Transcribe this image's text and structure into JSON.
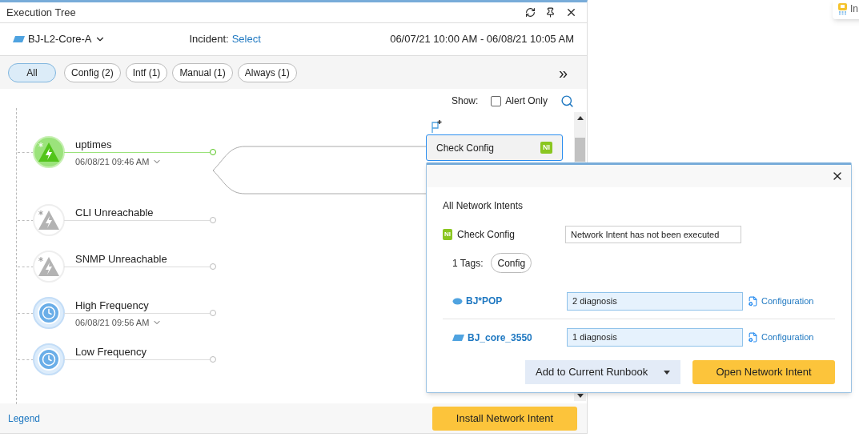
{
  "window": {
    "title": "Execution Tree"
  },
  "device": {
    "name": "BJ-L2-Core-A"
  },
  "incident": {
    "label": "Incident:",
    "link": "Select"
  },
  "time_range": "06/07/21 10:00 AM - 06/08/21 10:05 AM",
  "filters": [
    {
      "label": "All",
      "selected": true
    },
    {
      "label": "Config (2)",
      "selected": false
    },
    {
      "label": "Intf (1)",
      "selected": false
    },
    {
      "label": "Manual (1)",
      "selected": false
    },
    {
      "label": "Always (1)",
      "selected": false
    }
  ],
  "more": "»",
  "show": {
    "label": "Show:",
    "alert_only": {
      "label": "Alert Only",
      "checked": false
    }
  },
  "nodes": [
    {
      "kind": "trigger",
      "active": true,
      "name": "uptimes",
      "time": "06/08/21 09:46 AM"
    },
    {
      "kind": "trigger",
      "active": false,
      "name": "CLI Unreachable"
    },
    {
      "kind": "trigger",
      "active": false,
      "name": "SNMP Unreachable"
    },
    {
      "kind": "schedule",
      "active": false,
      "name": "High Frequency",
      "time": "06/08/21 09:56 AM"
    },
    {
      "kind": "schedule",
      "active": false,
      "name": "Low Frequency"
    }
  ],
  "intent_node": {
    "name": "Check Config",
    "badge": "NI",
    "selected": true
  },
  "popup": {
    "heading": "All Network Intents",
    "intent": {
      "badge": "NI",
      "name": "Check Config",
      "status": "Network Intent has not been executed"
    },
    "tags_label": "1 Tags:",
    "tags": [
      "Config"
    ],
    "devices": [
      {
        "kind": "router",
        "name": "BJ*POP",
        "diagnosis": "2 diagnosis",
        "link": "Configuration"
      },
      {
        "kind": "switch",
        "name": "BJ_core_3550",
        "diagnosis": "1 diagnosis",
        "link": "Configuration"
      }
    ],
    "add_button": "Add to Current Runbook",
    "open_button": "Open Network Intent"
  },
  "footer": {
    "legend": "Legend",
    "install_button": "Install Network Intent"
  },
  "corner_card": {
    "text": "In"
  }
}
